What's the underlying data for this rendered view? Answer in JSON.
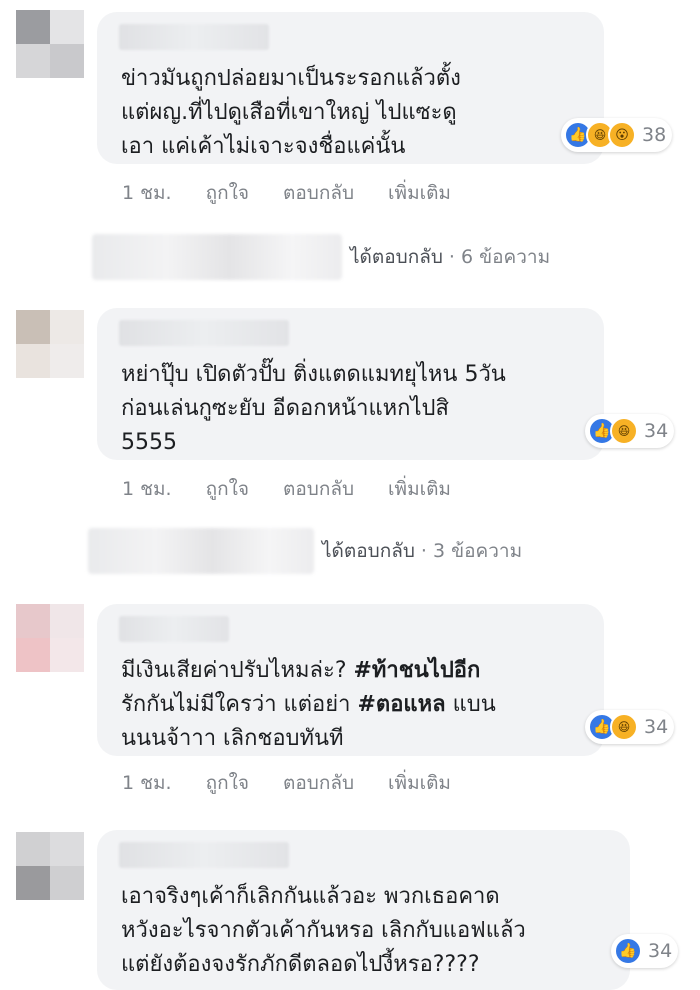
{
  "comments": [
    {
      "text_lines": [
        "ข่าวมันถูกปล่อยมาเป็นระรอกแล้วตั้ง",
        "แต่ผญ.ที่ไปดูเสือที่เขาใหญ่ ไปแซะดู",
        "เอา แค่เค้าไม่เจาะจงชื่อแค่นั้น"
      ],
      "reaction_icons": [
        "like-icon",
        "haha-icon",
        "wow-icon"
      ],
      "reaction_count": "38",
      "time": "1 ชม.",
      "like_label": "ถูกใจ",
      "reply_label": "ตอบกลับ",
      "more_label": "เพิ่มเติม",
      "replies_text": "ได้ตอบกลับ",
      "replies_count": "· 6 ข้อความ"
    },
    {
      "text_lines": [
        "หย่าปุ๊บ เปิดตัวปั๊บ ติ่งแตดแมทยุไหน 5วัน",
        "ก่อนเล่นกูซะยับ อีดอกหน้าแหกไปสิ",
        "5555"
      ],
      "reaction_icons": [
        "like-icon",
        "haha-icon"
      ],
      "reaction_count": "34",
      "time": "1 ชม.",
      "like_label": "ถูกใจ",
      "reply_label": "ตอบกลับ",
      "more_label": "เพิ่มเติม",
      "replies_text": "ได้ตอบกลับ",
      "replies_count": "· 3 ข้อความ"
    },
    {
      "line1_text": "มีเงินเสียค่าปรับไหมล่ะ?",
      "line1_hashtag": "#ท้าชนไปอีก",
      "line2_text": "รักกันไม่มีใครว่า แต่อย่า",
      "line2_hashtag": "#ตอแหล",
      "line2_tail": "แบน",
      "line3_text": "นนนจ้าาา เลิกชอบทันที",
      "reaction_icons": [
        "like-icon",
        "haha-icon"
      ],
      "reaction_count": "34",
      "time": "1 ชม.",
      "like_label": "ถูกใจ",
      "reply_label": "ตอบกลับ",
      "more_label": "เพิ่มเติม"
    },
    {
      "text_lines": [
        "เอาจริงๆเค้าก็เลิกกันแล้วอะ พวกเธอคาด",
        "หวังอะไรจากตัวเค้ากันหรอ เลิกกับแอฟแล้ว",
        "แต่ยังต้องจงรักภักดีตลอดไปงี้หรอ????"
      ],
      "reaction_icons": [
        "like-icon"
      ],
      "reaction_count": "34"
    }
  ],
  "colors": {
    "bubble_bg": "#f2f3f5",
    "like_blue": "#3578e5",
    "emoji_yellow": "#f7b125",
    "meta_gray": "#7f8389"
  }
}
